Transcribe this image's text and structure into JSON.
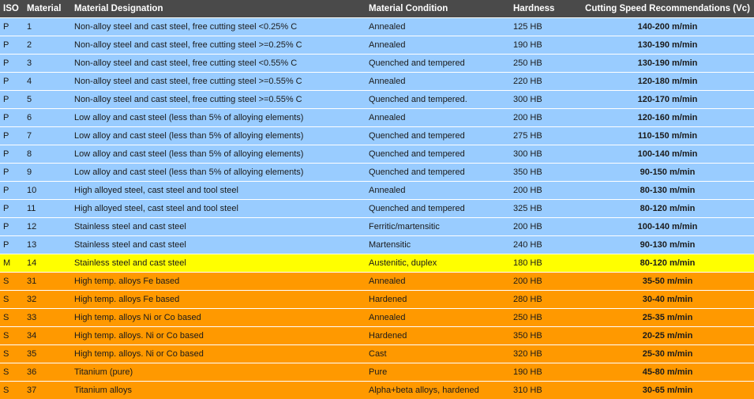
{
  "table": {
    "headers": {
      "iso": "ISO",
      "material": "Material",
      "designation": "Material Designation",
      "condition": "Material Condition",
      "hardness": "Hardness",
      "speed": "Cutting Speed Recommendations (Vc)"
    },
    "rows": [
      {
        "iso": "P",
        "material": "1",
        "designation": "Non-alloy steel and cast steel, free cutting steel <0.25% C",
        "condition": "Annealed",
        "hardness": "125 HB",
        "speed": "140-200 m/min"
      },
      {
        "iso": "P",
        "material": "2",
        "designation": "Non-alloy steel and cast steel, free cutting steel >=0.25% C",
        "condition": "Annealed",
        "hardness": "190 HB",
        "speed": "130-190 m/min"
      },
      {
        "iso": "P",
        "material": "3",
        "designation": "Non-alloy steel and cast steel, free cutting steel <0.55% C",
        "condition": "Quenched and tempered",
        "hardness": "250 HB",
        "speed": "130-190 m/min"
      },
      {
        "iso": "P",
        "material": "4",
        "designation": "Non-alloy steel and cast steel, free cutting steel >=0.55% C",
        "condition": "Annealed",
        "hardness": "220 HB",
        "speed": "120-180 m/min"
      },
      {
        "iso": "P",
        "material": "5",
        "designation": "Non-alloy steel and cast steel, free cutting steel >=0.55% C",
        "condition": "Quenched and tempered.",
        "hardness": "300 HB",
        "speed": "120-170 m/min"
      },
      {
        "iso": "P",
        "material": "6",
        "designation": "Low alloy and cast steel (less than 5% of alloying elements)",
        "condition": "Annealed",
        "hardness": "200 HB",
        "speed": "120-160 m/min"
      },
      {
        "iso": "P",
        "material": "7",
        "designation": "Low alloy and cast steel (less than 5% of alloying elements)",
        "condition": "Quenched and tempered",
        "hardness": "275 HB",
        "speed": "110-150 m/min"
      },
      {
        "iso": "P",
        "material": "8",
        "designation": "Low alloy and cast steel (less than 5% of alloying elements)",
        "condition": "Quenched and tempered",
        "hardness": "300 HB",
        "speed": "100-140 m/min"
      },
      {
        "iso": "P",
        "material": "9",
        "designation": "Low alloy and cast steel (less than 5% of alloying elements)",
        "condition": "Quenched and tempered",
        "hardness": "350 HB",
        "speed": "90-150 m/min"
      },
      {
        "iso": "P",
        "material": "10",
        "designation": "High alloyed steel, cast steel and tool steel",
        "condition": "Annealed",
        "hardness": "200 HB",
        "speed": "80-130 m/min"
      },
      {
        "iso": "P",
        "material": "11",
        "designation": "High alloyed steel, cast steel and tool steel",
        "condition": "Quenched and tempered",
        "hardness": "325 HB",
        "speed": "80-120 m/min"
      },
      {
        "iso": "P",
        "material": "12",
        "designation": "Stainless steel and cast steel",
        "condition": "Ferritic/martensitic",
        "hardness": "200 HB",
        "speed": "100-140 m/min"
      },
      {
        "iso": "P",
        "material": "13",
        "designation": "Stainless steel and cast steel",
        "condition": "Martensitic",
        "hardness": "240 HB",
        "speed": "90-130 m/min"
      },
      {
        "iso": "M",
        "material": "14",
        "designation": "Stainless steel and cast steel",
        "condition": "Austenitic, duplex",
        "hardness": "180 HB",
        "speed": "80-120 m/min"
      },
      {
        "iso": "S",
        "material": "31",
        "designation": "High temp. alloys Fe based",
        "condition": "Annealed",
        "hardness": "200 HB",
        "speed": "35-50 m/min"
      },
      {
        "iso": "S",
        "material": "32",
        "designation": "High temp. alloys Fe based",
        "condition": "Hardened",
        "hardness": "280 HB",
        "speed": "30-40 m/min"
      },
      {
        "iso": "S",
        "material": "33",
        "designation": "High temp. alloys Ni or Co based",
        "condition": "Annealed",
        "hardness": "250 HB",
        "speed": "25-35 m/min"
      },
      {
        "iso": "S",
        "material": "34",
        "designation": "High temp. alloys. Ni or Co based",
        "condition": "Hardened",
        "hardness": "350 HB",
        "speed": "20-25 m/min"
      },
      {
        "iso": "S",
        "material": "35",
        "designation": "High temp. alloys. Ni or Co based",
        "condition": "Cast",
        "hardness": "320 HB",
        "speed": "25-30 m/min"
      },
      {
        "iso": "S",
        "material": "36",
        "designation": "Titanium (pure)",
        "condition": "Pure",
        "hardness": "190 HB",
        "speed": "45-80 m/min"
      },
      {
        "iso": "S",
        "material": "37",
        "designation": "Titanium alloys",
        "condition": "Alpha+beta alloys, hardened",
        "hardness": "310 HB",
        "speed": "30-65 m/min"
      }
    ]
  }
}
